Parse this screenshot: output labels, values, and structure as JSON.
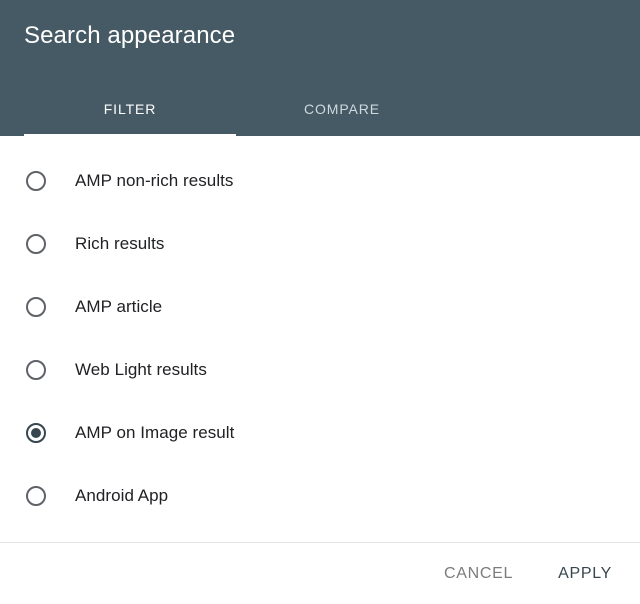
{
  "dialog": {
    "title": "Search appearance",
    "header_bg": "#455a64",
    "accent": "#37474f"
  },
  "tabs": [
    {
      "label": "FILTER",
      "active": true
    },
    {
      "label": "COMPARE",
      "active": false
    }
  ],
  "options": [
    {
      "label": "AMP non-rich results",
      "selected": false
    },
    {
      "label": "Rich results",
      "selected": false
    },
    {
      "label": "AMP article",
      "selected": false
    },
    {
      "label": "Web Light results",
      "selected": false
    },
    {
      "label": "AMP on Image result",
      "selected": true
    },
    {
      "label": "Android App",
      "selected": false
    }
  ],
  "footer": {
    "cancel_label": "CANCEL",
    "apply_label": "APPLY"
  }
}
